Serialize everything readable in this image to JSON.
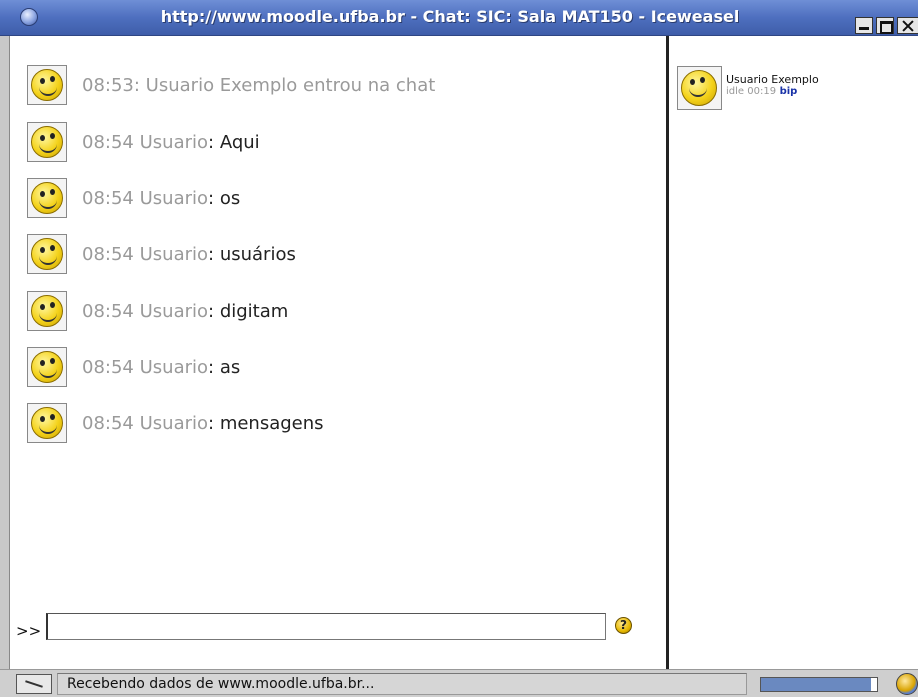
{
  "window": {
    "title": "http://www.moodle.ufba.br - Chat: SIC: Sala MAT150 - Iceweasel",
    "icon": "iceweasel-icon"
  },
  "messages": [
    {
      "time": "08:53:",
      "user": "Usuario Exemplo entrou na chat",
      "sep": "",
      "body": "",
      "system": true
    },
    {
      "time": "08:54",
      "user": "Usuario",
      "sep": ":",
      "body": "Aqui",
      "system": false
    },
    {
      "time": "08:54",
      "user": "Usuario",
      "sep": ":",
      "body": "os",
      "system": false
    },
    {
      "time": "08:54",
      "user": "Usuario",
      "sep": ":",
      "body": "usuários",
      "system": false
    },
    {
      "time": "08:54",
      "user": "Usuario",
      "sep": ":",
      "body": "digitam",
      "system": false
    },
    {
      "time": "08:54",
      "user": "Usuario",
      "sep": ":",
      "body": "as",
      "system": false
    },
    {
      "time": "08:54",
      "user": "Usuario",
      "sep": ":",
      "body": "mensagens",
      "system": false
    }
  ],
  "input": {
    "prompt": ">>",
    "value": "",
    "help_icon": "help-icon",
    "help_glyph": "?"
  },
  "users_list": [
    {
      "name": "Usuario Exemplo",
      "idle": "idle 00:19",
      "action": "bip"
    }
  ],
  "statusbar": {
    "text": "Recebendo dados de www.moodle.ufba.br...",
    "progress": 0.95
  },
  "colors": {
    "titlebar": "#4e6fbf",
    "link": "#1a33a8",
    "muted_text": "#9a9a9a"
  }
}
